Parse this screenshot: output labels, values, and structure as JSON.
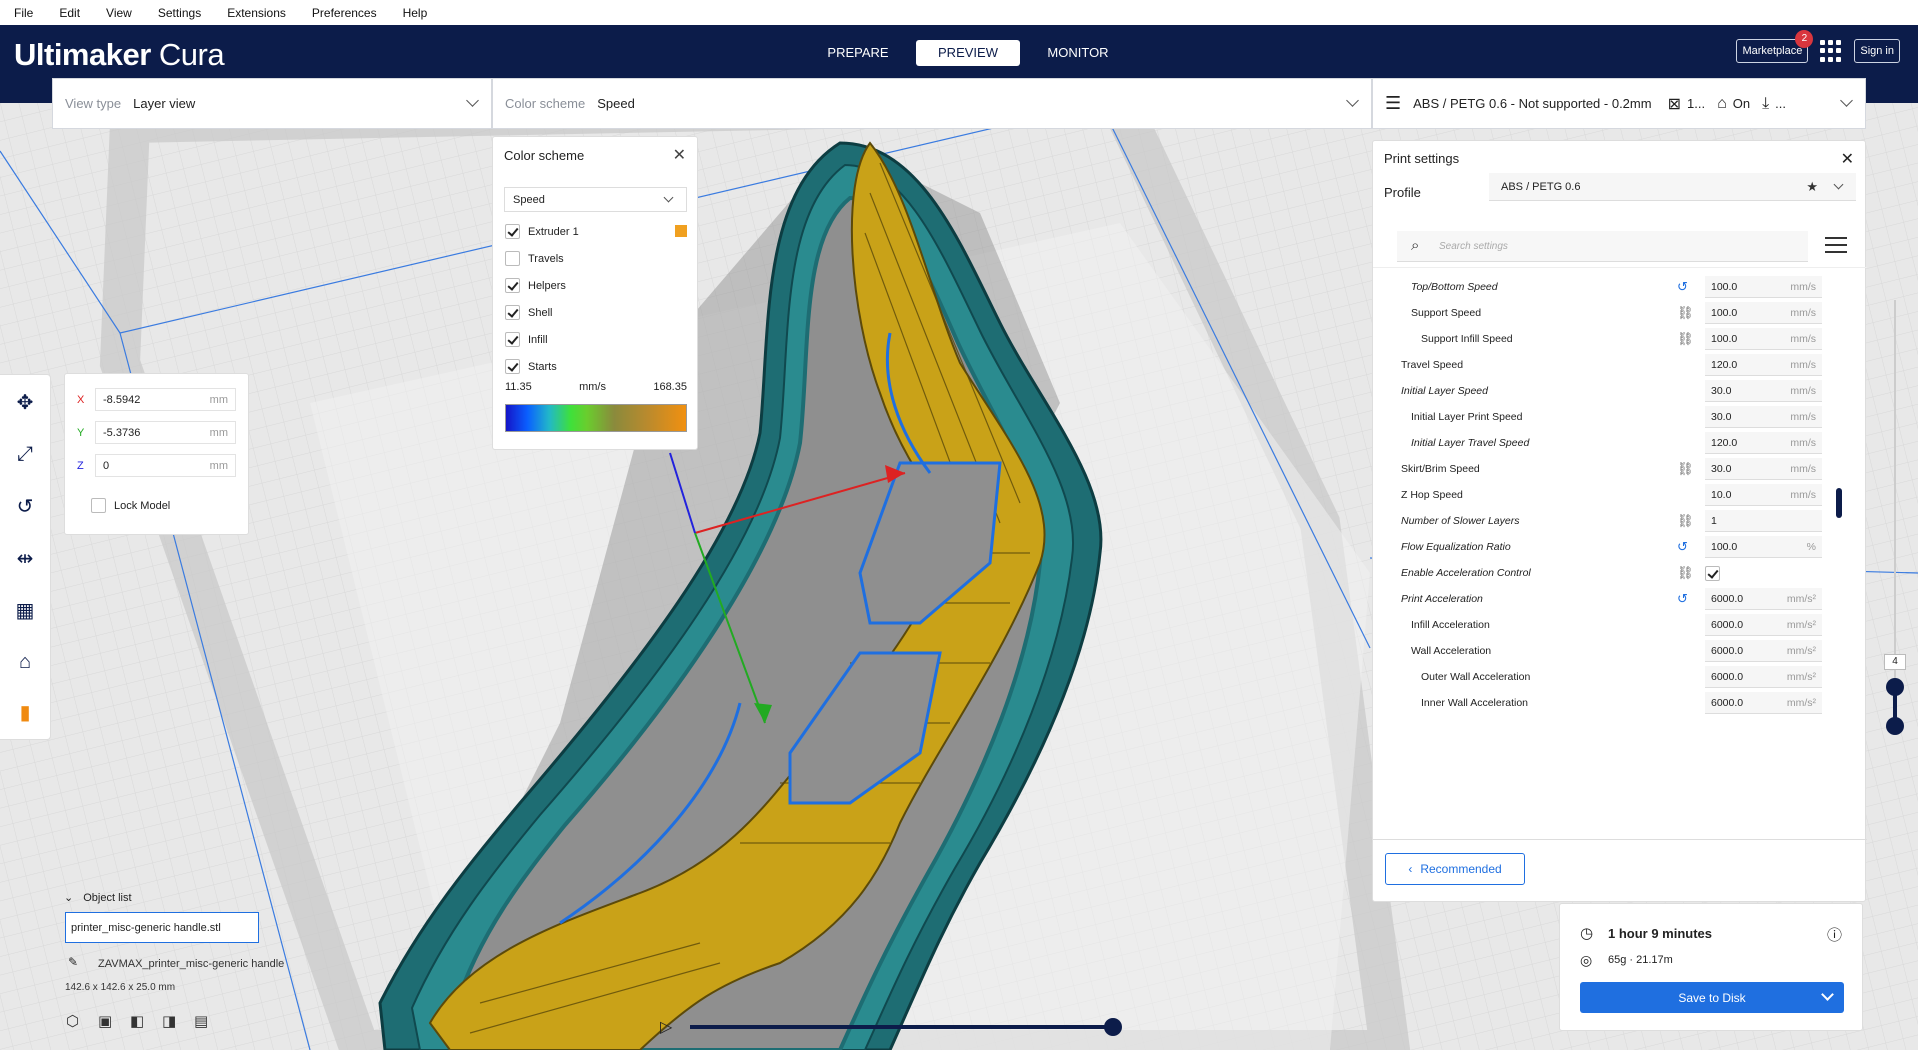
{
  "menu": [
    "File",
    "Edit",
    "View",
    "Settings",
    "Extensions",
    "Preferences",
    "Help"
  ],
  "brand": {
    "bold": "Ultimaker",
    "light": "Cura"
  },
  "stages": [
    {
      "label": "PREPARE"
    },
    {
      "label": "PREVIEW"
    },
    {
      "label": "MONITOR"
    }
  ],
  "topbar": {
    "marketplace": "Marketplace",
    "badge": "2",
    "signin": "Sign in"
  },
  "header": {
    "view_type_label": "View type",
    "view_type_value": "Layer view",
    "color_scheme_label": "Color scheme",
    "color_scheme_value": "Speed",
    "printer_profile": "ABS / PETG 0.6 - Not supported - 0.2mm",
    "support_value": "1...",
    "adhesion_value": "On",
    "more": "..."
  },
  "move": {
    "x_label": "X",
    "x_value": "-8.5942",
    "y_label": "Y",
    "y_value": "-5.3736",
    "z_label": "Z",
    "z_value": "0",
    "unit": "mm",
    "lock_label": "Lock Model"
  },
  "color_scheme_panel": {
    "title": "Color scheme",
    "selected": "Speed",
    "items": [
      {
        "label": "Extruder 1",
        "checked": true
      },
      {
        "label": "Travels",
        "checked": false
      },
      {
        "label": "Helpers",
        "checked": true
      },
      {
        "label": "Shell",
        "checked": true
      },
      {
        "label": "Infill",
        "checked": true
      },
      {
        "label": "Starts",
        "checked": true
      }
    ],
    "extruder_color": "#f0a020",
    "min": "11.35",
    "unit": "mm/s",
    "max": "168.35"
  },
  "print_settings": {
    "title": "Print settings",
    "profile_label": "Profile",
    "profile_value": "ABS / PETG 0.6",
    "search_placeholder": "Search settings",
    "rows": [
      {
        "name": "Top/Bottom Speed",
        "value": "100.0",
        "unit": "mm/s"
      },
      {
        "name": "Support Speed",
        "value": "100.0",
        "unit": "mm/s"
      },
      {
        "name": "Support Infill Speed",
        "value": "100.0",
        "unit": "mm/s"
      },
      {
        "name": "Travel Speed",
        "value": "120.0",
        "unit": "mm/s"
      },
      {
        "name": "Initial Layer Speed",
        "value": "30.0",
        "unit": "mm/s"
      },
      {
        "name": "Initial Layer Print Speed",
        "value": "30.0",
        "unit": "mm/s"
      },
      {
        "name": "Initial Layer Travel Speed",
        "value": "120.0",
        "unit": "mm/s"
      },
      {
        "name": "Skirt/Brim Speed",
        "value": "30.0",
        "unit": "mm/s"
      },
      {
        "name": "Z Hop Speed",
        "value": "10.0",
        "unit": "mm/s"
      },
      {
        "name": "Number of Slower Layers",
        "value": "1",
        "unit": ""
      },
      {
        "name": "Flow Equalization Ratio",
        "value": "100.0",
        "unit": "%"
      },
      {
        "name": "Enable Acceleration Control",
        "value": "",
        "unit": ""
      },
      {
        "name": "Print Acceleration",
        "value": "6000.0",
        "unit": "mm/s²"
      },
      {
        "name": "Infill Acceleration",
        "value": "6000.0",
        "unit": "mm/s²"
      },
      {
        "name": "Wall Acceleration",
        "value": "6000.0",
        "unit": "mm/s²"
      },
      {
        "name": "Outer Wall Acceleration",
        "value": "6000.0",
        "unit": "mm/s²"
      },
      {
        "name": "Inner Wall Acceleration",
        "value": "6000.0",
        "unit": "mm/s²"
      }
    ],
    "recommended": "Recommended"
  },
  "job": {
    "time": "1 hour 9 minutes",
    "material": "65g · 21.17m",
    "save": "Save to Disk"
  },
  "objects": {
    "header": "Object list",
    "field": "printer_misc-generic handle.stl",
    "name": "ZAVMAX_printer_misc-generic handle",
    "dims": "142.6 x 142.6 x 25.0 mm"
  },
  "layer": {
    "current": "4"
  }
}
